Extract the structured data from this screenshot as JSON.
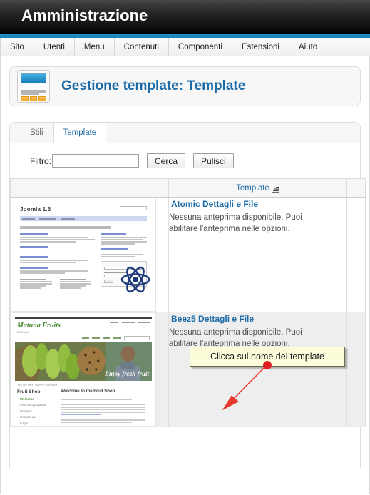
{
  "header": {
    "admin_title": "Amministrazione",
    "accent_blue": "#1b87bd"
  },
  "menu": {
    "items": [
      {
        "label": "Sito"
      },
      {
        "label": "Utenti"
      },
      {
        "label": "Menu"
      },
      {
        "label": "Contenuti"
      },
      {
        "label": "Componenti"
      },
      {
        "label": "Estensioni"
      },
      {
        "label": "Aiuto"
      }
    ]
  },
  "page": {
    "title": "Gestione template: Template",
    "title_color": "#1c6ca8",
    "icon": "template-manager-icon"
  },
  "tabs": [
    {
      "label": "Stili",
      "active": false
    },
    {
      "label": "Template",
      "active": true
    }
  ],
  "filter": {
    "label": "Filtro:",
    "value": "",
    "placeholder": "",
    "search_button": "Cerca",
    "clear_button": "Pulisci"
  },
  "table": {
    "columns": [
      {
        "label": "",
        "name": "preview"
      },
      {
        "label": "Template",
        "name": "template-name",
        "sortable": true,
        "sort_icon": "sort-ascending-icon"
      },
      {
        "label": "",
        "name": "end"
      }
    ],
    "rows": [
      {
        "name": "Atomic Dettagli e File",
        "description": "Nessuna anteprima disponibile. Puoi abilitare l'anteprima nelle opzioni.",
        "preview": "atomic-template-thumbnail",
        "preview_content": {
          "site_title": "Joomla 1.6",
          "headline": "Powerful Content Management and a Simple Extensible Framework",
          "logo": "atom-icon"
        }
      },
      {
        "name": "Beez5 Dettagli e File",
        "description": "Nessuna anteprima disponibile. Puoi abilitare l'anteprima nelle opzioni.",
        "preview": "beez5-template-thumbnail",
        "preview_content": {
          "brand": "Matuna Fruits",
          "banner_tagline": "Enjoy fresh fruit",
          "sidebar_title": "Fruit Shop",
          "content_title": "Welcome to the Fruit Shop"
        }
      }
    ]
  },
  "annotation": {
    "callout_text": "Clicca sul nome del template",
    "callout_bg": "#fcfbda",
    "callout_border": "#6b6b4f",
    "marker_color": "#e02020",
    "arrow_color": "#e8392f",
    "arrow_target": "Beez5 Dettagli e File"
  }
}
